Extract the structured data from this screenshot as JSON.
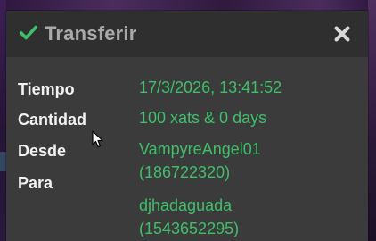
{
  "dialog": {
    "title": "Transferir",
    "title_icon": "check-icon",
    "close_icon": "close-icon",
    "accent_color": "#3fbf6a",
    "label_color": "#f2f2f2",
    "title_color": "#a9a9a9"
  },
  "details": {
    "time_label": "Tiempo",
    "time_value": "17/3/2026, 13:41:52",
    "amount_label": "Cantidad",
    "amount_value": "100 xats & 0 days",
    "from_label": "Desde",
    "from_name": "VampyreAngel01",
    "from_id": "(186722320)",
    "to_label": "Para",
    "to_name": "djhadaguada",
    "to_id": "(1543652295)"
  }
}
